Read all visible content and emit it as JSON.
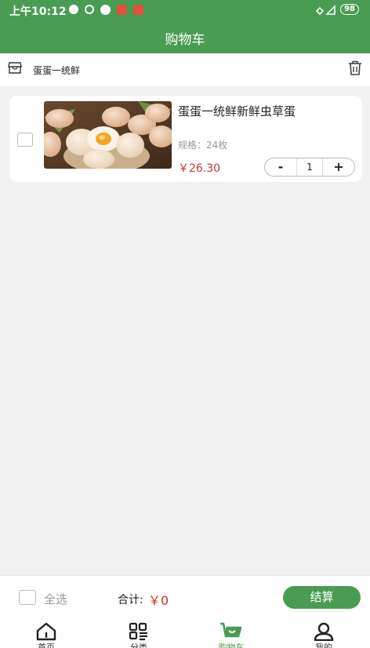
{
  "status_bar": {
    "time": "上午10:12",
    "battery": "98"
  },
  "header": {
    "title": "购物车"
  },
  "shop": {
    "name": "蛋蛋一统鲜"
  },
  "cart_items": [
    {
      "name": "蛋蛋一统鲜新鲜虫草蛋",
      "spec": "规格：24枚",
      "price": "￥26.30",
      "quantity": "1",
      "minus_label": "-",
      "plus_label": "+"
    }
  ],
  "footer": {
    "select_all_label": "全选",
    "total_label": "合计:",
    "total_value": "￥0",
    "checkout_label": "结算"
  },
  "tabbar": {
    "tabs": [
      {
        "label": "首页",
        "icon": "home-icon"
      },
      {
        "label": "分类",
        "icon": "category-icon"
      },
      {
        "label": "购物车",
        "icon": "cart-icon",
        "active": true
      },
      {
        "label": "我的",
        "icon": "user-icon"
      }
    ]
  },
  "colors": {
    "accent": "#4a9c52",
    "price": "#c0392b"
  }
}
